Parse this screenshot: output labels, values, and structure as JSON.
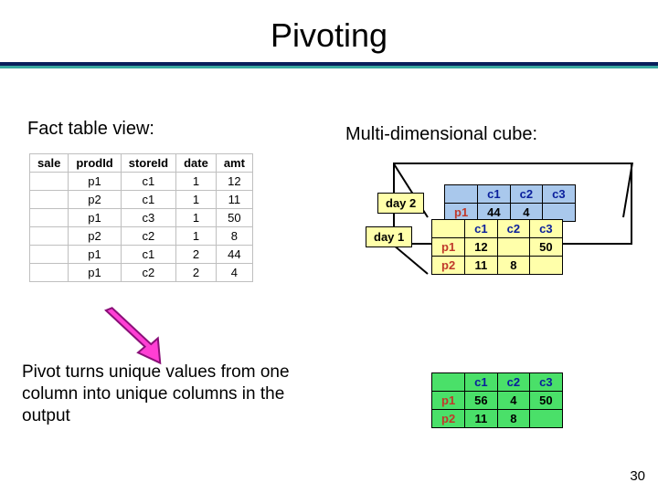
{
  "title": "Pivoting",
  "label_fact": "Fact table view:",
  "label_cube": "Multi-dimensional cube:",
  "fact_headers": [
    "sale",
    "prodId",
    "storeId",
    "date",
    "amt"
  ],
  "fact_rows": [
    [
      "",
      "p1",
      "c1",
      "1",
      "12"
    ],
    [
      "",
      "p2",
      "c1",
      "1",
      "11"
    ],
    [
      "",
      "p1",
      "c3",
      "1",
      "50"
    ],
    [
      "",
      "p2",
      "c2",
      "1",
      "8"
    ],
    [
      "",
      "p1",
      "c1",
      "2",
      "44"
    ],
    [
      "",
      "p1",
      "c2",
      "2",
      "4"
    ]
  ],
  "day2": "day 2",
  "day1": "day 1",
  "pt_blue": {
    "cols": [
      "",
      "c1",
      "c2",
      "c3"
    ],
    "rows": [
      [
        "p1",
        "44",
        "4",
        ""
      ]
    ]
  },
  "pt_yellow": {
    "cols": [
      "",
      "c1",
      "c2",
      "c3"
    ],
    "rows": [
      [
        "p1",
        "12",
        "",
        "50"
      ],
      [
        "p2",
        "11",
        "8",
        ""
      ]
    ]
  },
  "pt_green": {
    "cols": [
      "",
      "c1",
      "c2",
      "c3"
    ],
    "rows": [
      [
        "p1",
        "56",
        "4",
        "50"
      ],
      [
        "p2",
        "11",
        "8",
        ""
      ]
    ]
  },
  "desc": "Pivot turns unique values from one column into unique columns in the output",
  "pagenum": "30"
}
